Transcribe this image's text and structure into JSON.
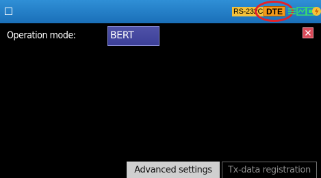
{
  "statusbar": {
    "interface_label": "RS-232C",
    "mode_label": "DTE",
    "accent_color": "#f59a1a",
    "icons": [
      "menu-icon",
      "connector-icon",
      "signal-icon",
      "card-icon",
      "power-icon"
    ]
  },
  "main": {
    "operation_mode_label": "Operation mode:",
    "operation_mode_value": "BERT"
  },
  "tabs": {
    "advanced_settings": "Advanced settings",
    "tx_data_registration": "Tx-data registration"
  }
}
